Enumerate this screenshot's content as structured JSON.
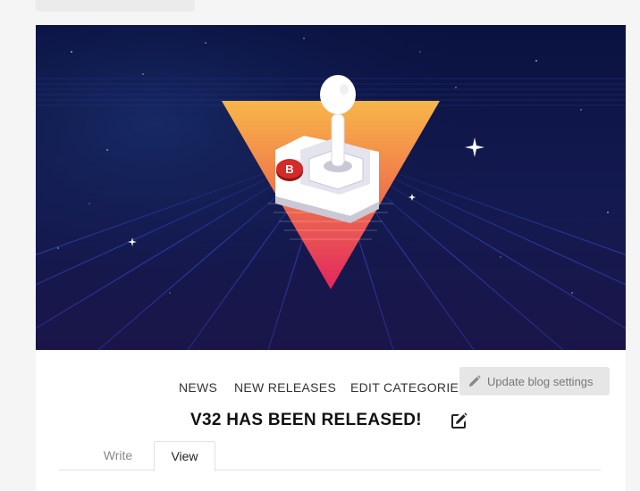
{
  "categories": [
    "NEWS",
    "NEW RELEASES",
    "EDIT CATEGORIES"
  ],
  "update_button": {
    "label": "Update blog settings",
    "icon": "pencil-icon"
  },
  "post": {
    "title": "V32 HAS BEEN RELEASED!",
    "edit_icon": "edit-square-icon"
  },
  "tabs": [
    {
      "label": "Write",
      "active": false
    },
    {
      "label": "View",
      "active": true
    }
  ],
  "hero": {
    "logo_letter": "B",
    "colors": {
      "sky_top": "#0c1445",
      "sky_bottom": "#161a4a",
      "grid": "#3a4fd8",
      "triangle_top": "#f7b548",
      "triangle_bottom": "#e8305e"
    }
  }
}
